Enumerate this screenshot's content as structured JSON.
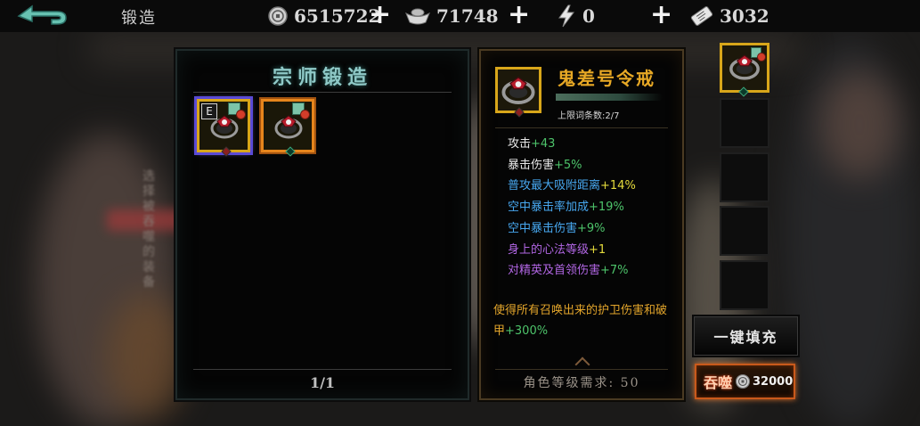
{
  "header": {
    "title": "锻造",
    "resources": [
      {
        "name": "coin",
        "icon": "coin-icon",
        "value": "6515722"
      },
      {
        "name": "ingot",
        "icon": "ingot-icon",
        "value": "71748"
      },
      {
        "name": "stamina",
        "icon": "lightning-icon",
        "value": "0"
      },
      {
        "name": "ticket",
        "icon": "ticket-icon",
        "value": "3032"
      }
    ]
  },
  "background": {
    "vertical_hint": "选择被吞噬的装备"
  },
  "forge_panel": {
    "title": "宗师锻造",
    "items": [
      {
        "name": "鬼差号令戒",
        "badge": "E",
        "selected": true
      },
      {
        "name": "鬼差号令戒",
        "badge": "",
        "selected": false
      }
    ],
    "page": "1/1"
  },
  "detail": {
    "name": "鬼差号令戒",
    "entry_count": "上限词条数:2/7",
    "stats": [
      {
        "label": "攻击",
        "value": "+43",
        "tier": "white"
      },
      {
        "label": "暴击伤害",
        "value": "+5%",
        "tier": "white"
      },
      {
        "label": "普攻最大吸附距离",
        "value": "+14%",
        "tier": "blue"
      },
      {
        "label": "空中暴击率加成",
        "value": "+19%",
        "tier": "blue"
      },
      {
        "label": "空中暴击伤害",
        "value": "+9%",
        "tier": "blue"
      },
      {
        "label": "身上的心法等级",
        "value": "+1",
        "tier": "purple"
      },
      {
        "label": "对精英及首领伤害",
        "value": "+7%",
        "tier": "purple"
      }
    ],
    "skill_text": "使得所有召唤出来的护卫伤害和破甲",
    "skill_value": "+300%",
    "requirement": "角色等级需求: 50"
  },
  "materials": {
    "slots": [
      {
        "filled": true
      },
      {
        "filled": false
      },
      {
        "filled": false
      },
      {
        "filled": false
      },
      {
        "filled": false
      }
    ]
  },
  "buttons": {
    "fill": "一键填充",
    "devour": "吞噬",
    "devour_cost": "32000"
  },
  "colors": {
    "gold_border": "#d8a61a",
    "orange_border": "#e6851c",
    "title_teal": "#8fc9c7",
    "name_gold": "#e7a825",
    "stat_blue": "#47a7ef",
    "stat_purple": "#b166e3",
    "stat_green": "#4dc36a",
    "stat_yellow": "#e5db3c"
  }
}
